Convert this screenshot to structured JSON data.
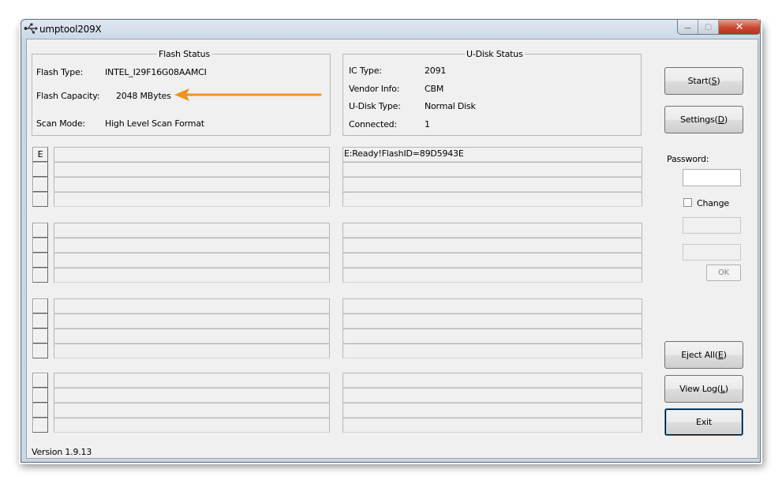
{
  "window": {
    "title": "umptool209X",
    "minimize_glyph": "—",
    "maximize_glyph": "▢",
    "close_glyph": "✕",
    "icon": "usb-icon"
  },
  "flash_status": {
    "legend": "Flash Status",
    "type_label": "Flash Type:",
    "type_value": "INTEL_I29F16G08AAMCI",
    "capacity_label": "Flash Capacity:",
    "capacity_value": "2048 MBytes",
    "scan_label": "Scan Mode:",
    "scan_value": "High Level Scan Format"
  },
  "udisk_status": {
    "legend": "U-Disk Status",
    "ic_label": "IC Type:",
    "ic_value": "2091",
    "vendor_label": "Vendor Info:",
    "vendor_value": "CBM",
    "udtype_label": "U-Disk Type:",
    "udtype_value": "Normal Disk",
    "connected_label": "Connected:",
    "connected_value": "1"
  },
  "ports": {
    "first_drive_letter": "E",
    "first_status": "E:Ready!FlashID=89D5943E"
  },
  "buttons": {
    "start": {
      "text": "Start(",
      "key": "S",
      "end": ")"
    },
    "settings": {
      "text": "Settings(",
      "key": "D",
      "end": ")"
    },
    "eject": {
      "text": "Eject All(",
      "key": "E",
      "end": ")"
    },
    "viewlog": {
      "text": "View Log(",
      "key": "L",
      "end": ")"
    },
    "exit": "Exit",
    "ok": "OK"
  },
  "password": {
    "label": "Password:",
    "change_label": "Change",
    "change_checked": false
  },
  "version": "Version 1.9.13",
  "annotation": {
    "arrow_color": "#f0921c"
  }
}
